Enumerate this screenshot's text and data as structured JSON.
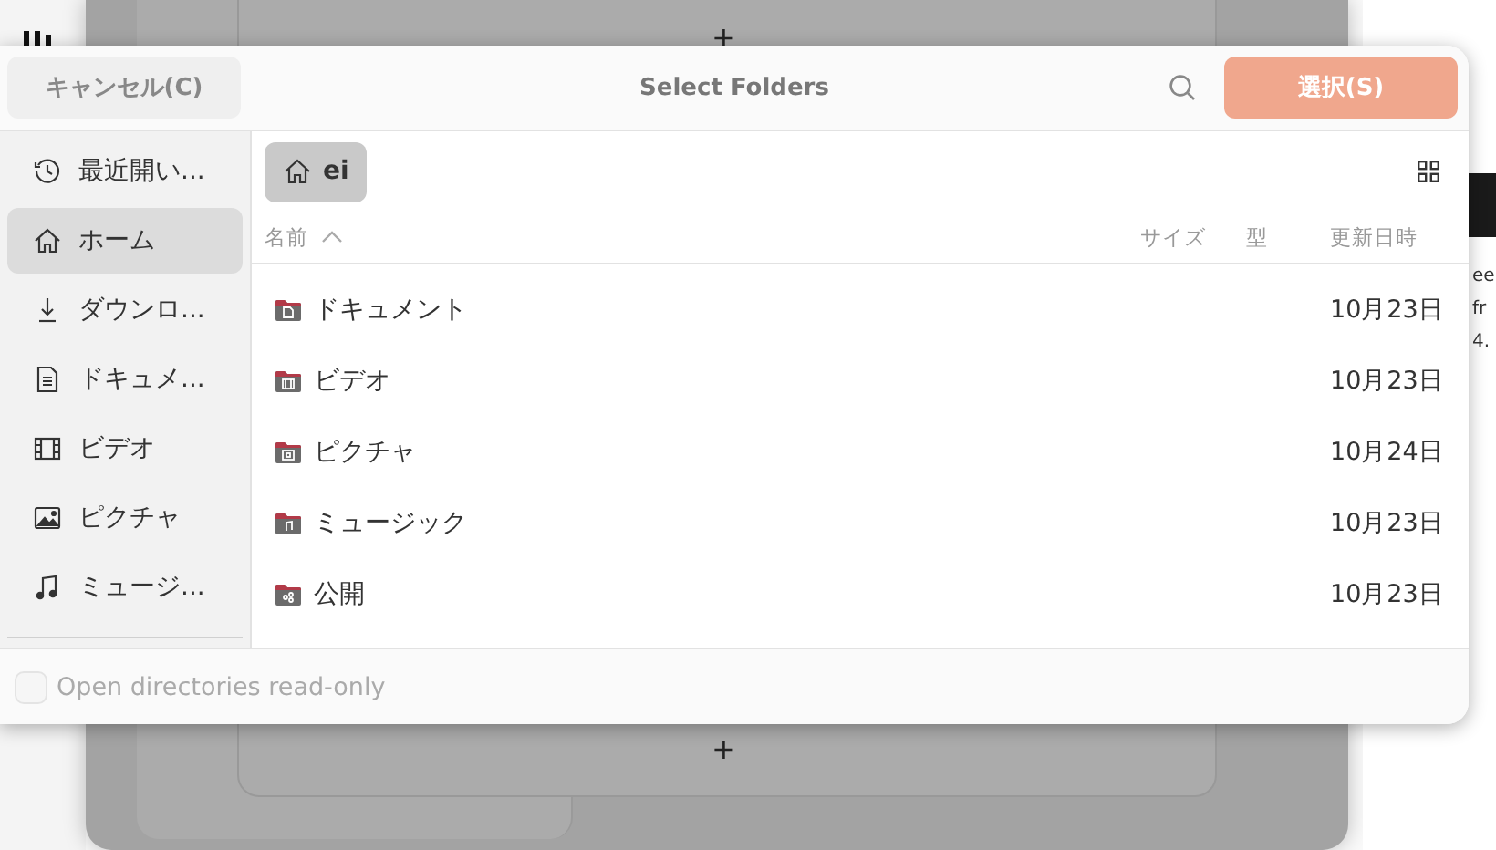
{
  "background": {
    "plus_signs": [
      "+",
      "+"
    ],
    "side_texts": [
      "ee",
      "fr",
      "4."
    ]
  },
  "dialog": {
    "cancel_button": "キャンセル(C)",
    "title": "Select Folders",
    "select_button": "選択(S)",
    "sidebar": {
      "items": [
        {
          "label": "最近開い...",
          "kind": "recent",
          "selected": false
        },
        {
          "label": "ホーム",
          "kind": "home",
          "selected": true
        },
        {
          "label": "ダウンロ...",
          "kind": "download",
          "selected": false
        },
        {
          "label": "ドキュメ...",
          "kind": "document",
          "selected": false
        },
        {
          "label": "ビデオ",
          "kind": "video",
          "selected": false
        },
        {
          "label": "ピクチャ",
          "kind": "picture",
          "selected": false
        },
        {
          "label": "ミュージ...",
          "kind": "music",
          "selected": false
        }
      ]
    },
    "path": {
      "label": "ei"
    },
    "table": {
      "columns": [
        {
          "label": "名前",
          "sorted": true
        },
        {
          "label": "サイズ",
          "sorted": false
        },
        {
          "label": "型",
          "sorted": false
        },
        {
          "label": "更新日時",
          "sorted": false
        }
      ],
      "rows": [
        {
          "name": "ドキュメント",
          "kind": "document",
          "modified": "10月23日"
        },
        {
          "name": "ビデオ",
          "kind": "video",
          "modified": "10月23日"
        },
        {
          "name": "ピクチャ",
          "kind": "picture",
          "modified": "10月24日"
        },
        {
          "name": "ミュージック",
          "kind": "music",
          "modified": "10月23日"
        },
        {
          "name": "公開",
          "kind": "share",
          "modified": "10月23日"
        }
      ]
    },
    "footer": {
      "checkbox": {
        "label": "Open directories read-only",
        "checked": false
      }
    }
  }
}
